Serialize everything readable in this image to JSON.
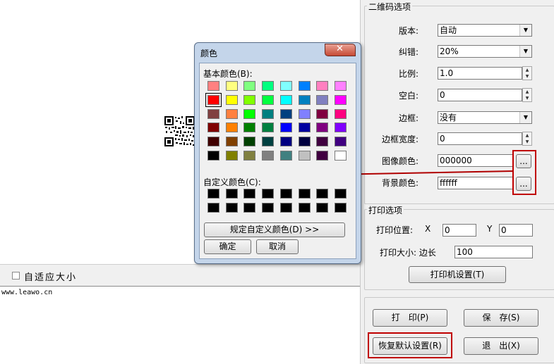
{
  "qr_panel": {
    "checkbox_label": "自适应大小"
  },
  "text_area": {
    "value": "www.leawo.cn"
  },
  "qr_options": {
    "title": "二维码选项",
    "version_label": "版本:",
    "version_value": "自动",
    "ecc_label": "纠错:",
    "ecc_value": "20%",
    "scale_label": "比例:",
    "scale_value": "1.0",
    "margin_label": "空白:",
    "margin_value": "0",
    "border_label": "边框:",
    "border_value": "没有",
    "border_width_label": "边框宽度:",
    "border_width_value": "0",
    "image_color_label": "图像颜色:",
    "image_color_value": "000000",
    "bg_color_label": "背景颜色:",
    "bg_color_value": "ffffff",
    "browse_label": "..."
  },
  "print_options": {
    "title": "打印选项",
    "position_label": "打印位置:",
    "x_label": "X",
    "x_value": "0",
    "y_label": "Y",
    "y_value": "0",
    "size_label": "打印大小: 边长",
    "size_value": "100",
    "printer_settings_label": "打印机设置(T)"
  },
  "actions": {
    "print_label": "打　印(P)",
    "save_label": "保　存(S)",
    "restore_label": "恢复默认设置(R)",
    "exit_label": "退　出(X)"
  },
  "color_dialog": {
    "title": "颜色",
    "basic_label": "基本颜色(B):",
    "custom_label": "自定义颜色(C):",
    "define_custom_label": "规定自定义颜色(D) >>",
    "ok_label": "确定",
    "cancel_label": "取消",
    "basic_colors": [
      "#ff8080",
      "#ffff80",
      "#80ff80",
      "#00ff80",
      "#80ffff",
      "#0080ff",
      "#ff80c0",
      "#ff80ff",
      "#ff0000",
      "#ffff00",
      "#80ff00",
      "#00ff40",
      "#00ffff",
      "#0080c0",
      "#8080c0",
      "#ff00ff",
      "#804040",
      "#ff8040",
      "#00ff00",
      "#008080",
      "#004080",
      "#8080ff",
      "#800040",
      "#ff0080",
      "#800000",
      "#ff8000",
      "#008000",
      "#008040",
      "#0000ff",
      "#0000a0",
      "#800080",
      "#8000ff",
      "#400000",
      "#804000",
      "#004000",
      "#004040",
      "#000080",
      "#000040",
      "#400040",
      "#400080",
      "#000000",
      "#808000",
      "#808040",
      "#808080",
      "#408080",
      "#c0c0c0",
      "#400040",
      "#ffffff"
    ],
    "selected_index": 8
  }
}
